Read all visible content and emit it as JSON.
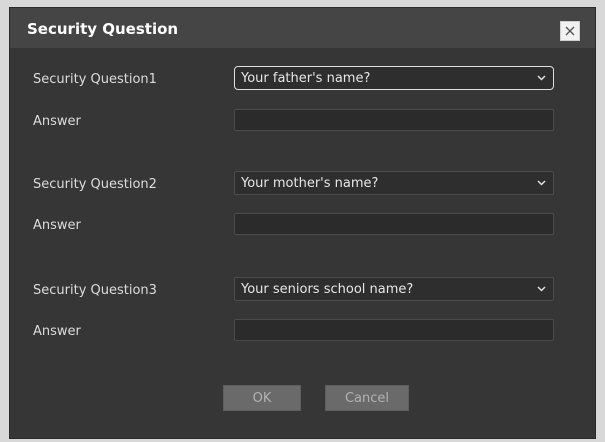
{
  "dialog": {
    "title": "Security Question",
    "close_icon": "close-icon"
  },
  "questions": [
    {
      "label": "Security Question1",
      "selected": "Your father's name?",
      "answer_label": "Answer",
      "answer_value": ""
    },
    {
      "label": "Security Question2",
      "selected": "Your mother's name?",
      "answer_label": "Answer",
      "answer_value": ""
    },
    {
      "label": "Security Question3",
      "selected": "Your seniors school name?",
      "answer_label": "Answer",
      "answer_value": ""
    }
  ],
  "buttons": {
    "ok_label": "OK",
    "cancel_label": "Cancel"
  },
  "colors": {
    "dialog_bg": "#363636",
    "title_bar_bg": "#454545",
    "button_bg": "#6a6a6a"
  }
}
